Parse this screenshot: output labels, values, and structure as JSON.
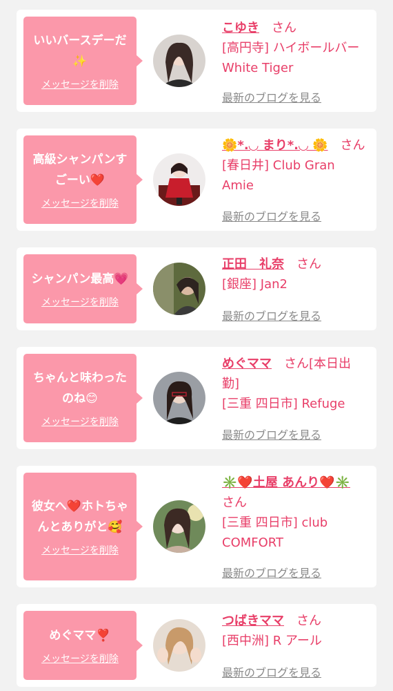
{
  "delete_label": "メッセージを削除",
  "blog_label": "最新のブログを見る",
  "san": "さん",
  "cards": [
    {
      "message": "いいバースデーだ✨",
      "name": "こゆき",
      "suffix": "",
      "shop": "[高円寺] ハイボールバー White Tiger"
    },
    {
      "message": "高級シャンパンすごーい❤️",
      "name": "🌼*.◡ まり*.◡ 🌼",
      "suffix": "",
      "shop": "[春日井] Club Gran Amie"
    },
    {
      "message": "シャンパン最高💗",
      "name": "正田　礼奈",
      "suffix": "",
      "shop": "[銀座] Jan2"
    },
    {
      "message": "ちゃんと味わったのね😊",
      "name": "めぐママ",
      "suffix": "[本日出勤]",
      "shop": "[三重 四日市] Refuge"
    },
    {
      "message": "彼女へ❤️ホトちゃんとありがと🥰",
      "name": "✳️❤️土屋 あんり❤️✳️",
      "suffix": "",
      "shop": "[三重 四日市] club COMFORT"
    },
    {
      "message": "めぐママ❣️",
      "name": "つばきママ",
      "suffix": "",
      "shop": "[西中洲] R アール"
    }
  ],
  "colors": {
    "accent": "#e83e68",
    "bubble": "#fb98aa",
    "link_gray": "#8a8a8a"
  }
}
